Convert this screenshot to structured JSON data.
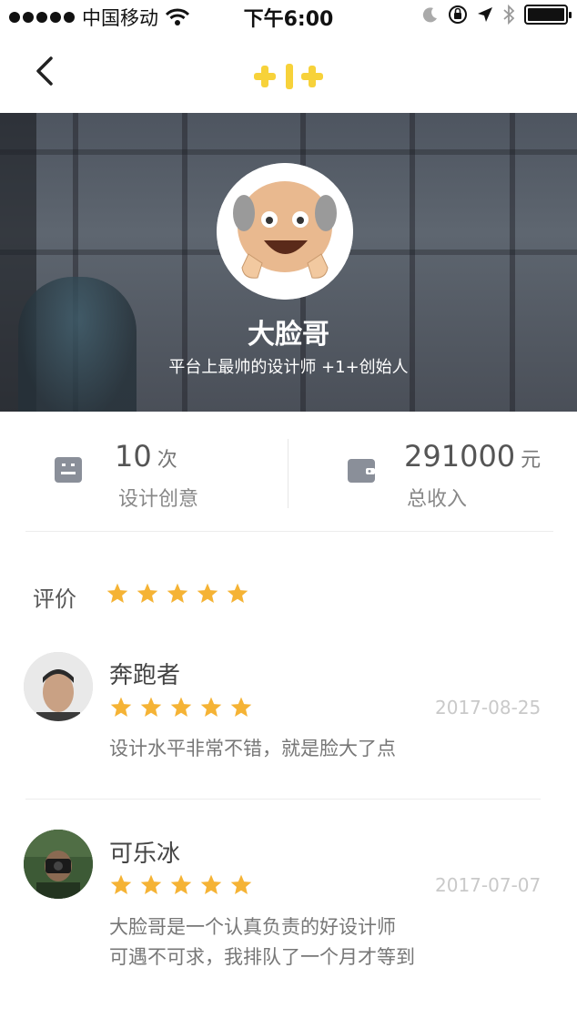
{
  "status_bar": {
    "carrier": "中国移动",
    "time": "下午6:00"
  },
  "colors": {
    "brand_yellow": "#F7D23A",
    "star_orange": "#F5B335",
    "icon_gray": "#8a8f99"
  },
  "profile": {
    "name": "大脸哥",
    "tagline": "平台上最帅的设计师 +1+创始人"
  },
  "stats": [
    {
      "value": "10",
      "unit": "次",
      "label": "设计创意",
      "icon": "list-icon"
    },
    {
      "value": "291000",
      "unit": "元",
      "label": "总收入",
      "icon": "wallet-icon"
    }
  ],
  "rating": {
    "label": "评价",
    "stars": 5
  },
  "reviews": [
    {
      "name": "奔跑者",
      "date": "2017-08-25",
      "stars": 5,
      "text": "设计水平非常不错，就是脸大了点"
    },
    {
      "name": "可乐冰",
      "date": "2017-07-07",
      "stars": 5,
      "text_line1": "大脸哥是一个认真负责的好设计师",
      "text_line2": "可遇不可求，我排队了一个月才等到"
    }
  ]
}
